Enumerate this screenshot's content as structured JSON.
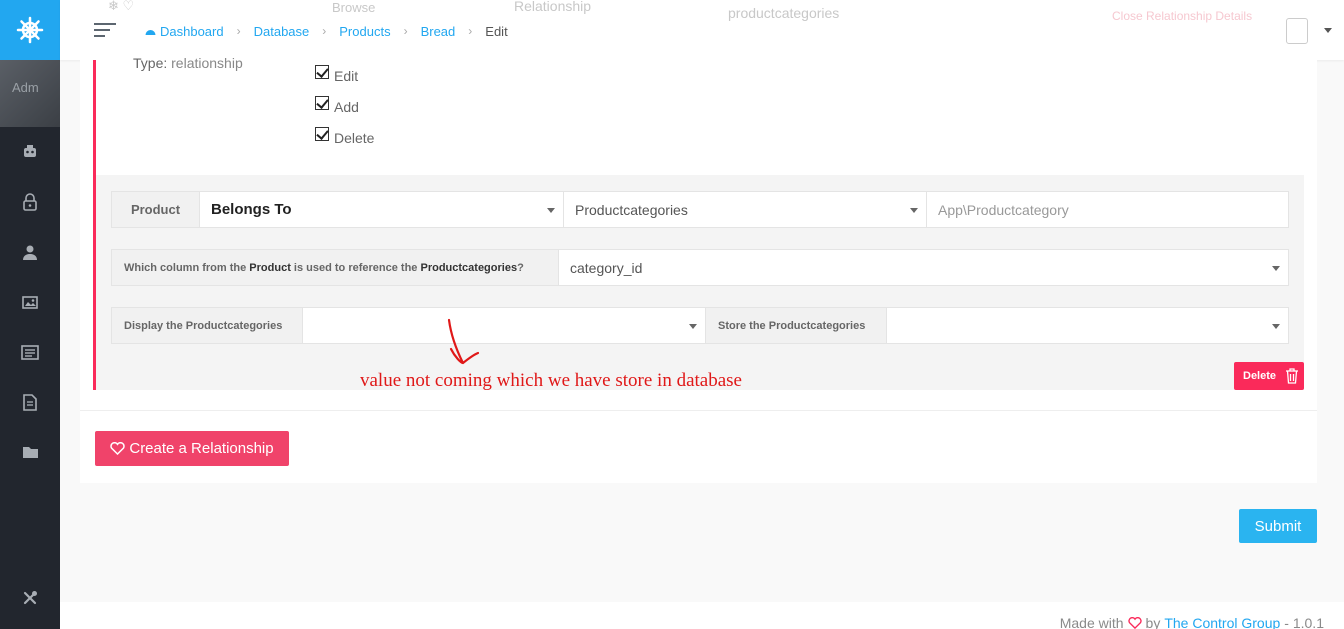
{
  "sidebar": {
    "user_text": "Adm",
    "nav": [
      "robot-icon",
      "lock-icon",
      "user-icon",
      "images-icon",
      "news-icon",
      "document-icon",
      "folder-icon"
    ],
    "bottom": "tools-icon"
  },
  "header": {
    "ghost_left": "Browse",
    "ghost_relationship": "Relationship",
    "ghost_value": "productcategories",
    "ghost_close": "Close Relationship Details",
    "breadcrumb": {
      "dashboard": "Dashboard",
      "database": "Database",
      "products": "Products",
      "bread": "Bread",
      "edit": "Edit"
    }
  },
  "field": {
    "type_prefix": "Type:",
    "type_value": "relationship",
    "checks": [
      "Edit",
      "Add",
      "Delete"
    ]
  },
  "relationship": {
    "model": "Product",
    "type": "Belongs To",
    "table": "Productcategories",
    "namespace": "App\\Productcategory",
    "column_q_prefix": "Which column from the",
    "column_q_model": "Product",
    "column_q_mid": "is used to reference the",
    "column_q_table": "Productcategories",
    "column_q_end": "?",
    "column_value": "category_id",
    "display_prefix": "Display the",
    "display_table": "Productcategories",
    "display_value": "",
    "store_prefix": "Store the",
    "store_table": "Productcategories",
    "store_value": "",
    "delete_label": "Delete"
  },
  "annotation": "value not coming which we have store in database",
  "actions": {
    "create_label": "Create a Relationship",
    "submit_label": "Submit"
  },
  "footer": {
    "made_with": "Made with",
    "by": "by",
    "company": "The Control Group",
    "version": "- 1.0.1"
  },
  "colors": {
    "accent": "#22a7f0",
    "danger": "#fa2a5a",
    "sidebar": "#22262e",
    "annotation": "#e01818"
  }
}
